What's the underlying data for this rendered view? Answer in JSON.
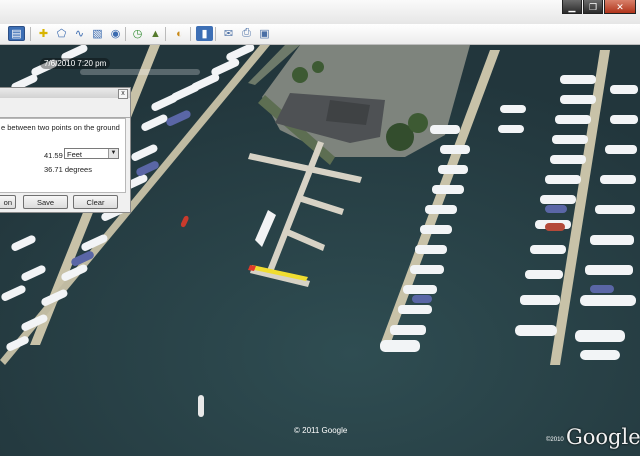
{
  "window": {
    "minimize_label": "▁",
    "maximize_label": "❐",
    "close_label": "✕"
  },
  "toolbar": {
    "icons": [
      "sidebar-icon",
      "placemark-icon",
      "polygon-icon",
      "path-icon",
      "image-overlay-icon",
      "tour-icon",
      "historical-imagery-icon",
      "sunlight-icon",
      "planets-icon",
      "ruler-icon",
      "email-icon",
      "print-icon",
      "save-image-icon"
    ]
  },
  "map": {
    "timestamp": "7/6/2010  7:20 pm",
    "copyright": "© 2011 Google",
    "logo_small": "©2010",
    "logo": "Google"
  },
  "ruler_dialog": {
    "description": "e between two points on the ground",
    "length_value": "41.59",
    "unit_selected": "Feet",
    "heading_value": "36.71 degrees",
    "left_button_fragment": "on",
    "save_label": "Save",
    "clear_label": "Clear",
    "close_label": "x"
  },
  "colors": {
    "water": "#263a40",
    "ruler_line": "#f0dd30",
    "toolbar_accent": "#3d6fb5"
  }
}
